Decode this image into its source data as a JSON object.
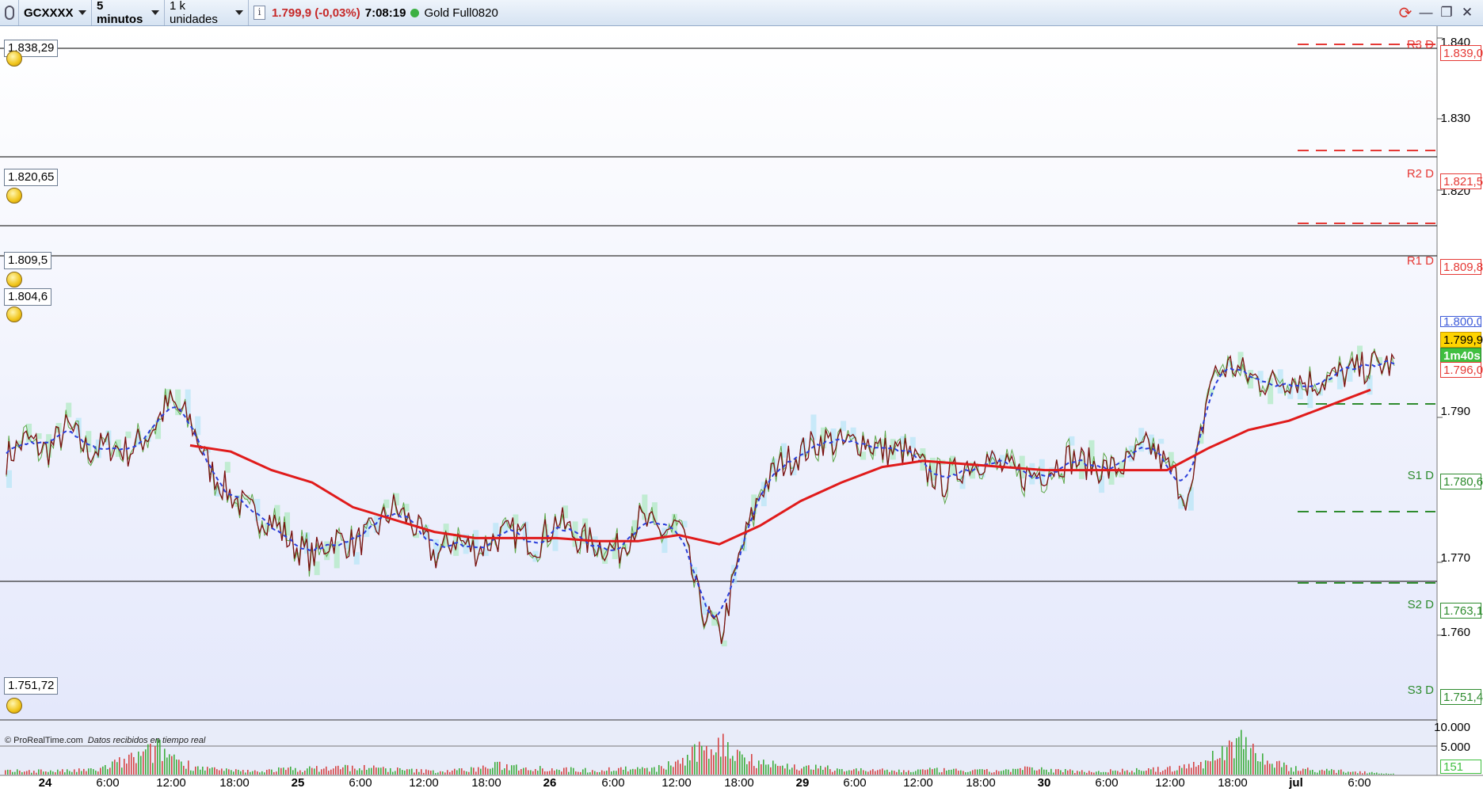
{
  "toolbar": {
    "symbol": "GCXXXX",
    "timeframe": "5 minutos",
    "units": "1 k unidades",
    "info_icon": "info-icon",
    "last_price": "1.799,9 (-0,03%)",
    "time": "7:08:19",
    "instrument": "Gold Full0820",
    "icons": [
      "sync-icon",
      "minimize-icon",
      "restore-icon",
      "close-icon"
    ]
  },
  "alerts": [
    {
      "price": "1.838,29"
    },
    {
      "price": "1.820,65"
    },
    {
      "price": "1.809,5"
    },
    {
      "price": "1.804,6"
    },
    {
      "price": "1.751,72"
    }
  ],
  "pivots": [
    {
      "label": "R3 D",
      "value": "1.839,0",
      "color": "#e53935"
    },
    {
      "label": "R2 D",
      "value": "1.821,5",
      "color": "#e53935"
    },
    {
      "label": "R1 D",
      "value": "1.809,8",
      "color": "#e53935"
    },
    {
      "label": "S1 D",
      "value": "1.780,6",
      "color": "#2e8b2e"
    },
    {
      "label": "S2 D",
      "value": "1.763,1",
      "color": "#2e8b2e"
    },
    {
      "label": "S3 D",
      "value": "1.751,4",
      "color": "#2e8b2e"
    }
  ],
  "y_axis": [
    "1.840",
    "1.830",
    "1.820",
    "1.790",
    "1.770",
    "1.760"
  ],
  "axis_badges": {
    "current_price": "1.799,9",
    "countdown": "1m40s",
    "ma_value": "1.796,0",
    "prev_value": "1.800,0"
  },
  "volume_axis": [
    "10.000",
    "5.000"
  ],
  "volume_current": "151",
  "x_axis": [
    {
      "label": "24",
      "bold": true
    },
    {
      "label": "6:00",
      "bold": false
    },
    {
      "label": "12:00",
      "bold": false
    },
    {
      "label": "18:00",
      "bold": false
    },
    {
      "label": "25",
      "bold": true
    },
    {
      "label": "6:00",
      "bold": false
    },
    {
      "label": "12:00",
      "bold": false
    },
    {
      "label": "18:00",
      "bold": false
    },
    {
      "label": "26",
      "bold": true
    },
    {
      "label": "6:00",
      "bold": false
    },
    {
      "label": "12:00",
      "bold": false
    },
    {
      "label": "18:00",
      "bold": false
    },
    {
      "label": "29",
      "bold": true
    },
    {
      "label": "6:00",
      "bold": false
    },
    {
      "label": "12:00",
      "bold": false
    },
    {
      "label": "18:00",
      "bold": false
    },
    {
      "label": "30",
      "bold": true
    },
    {
      "label": "6:00",
      "bold": false
    },
    {
      "label": "12:00",
      "bold": false
    },
    {
      "label": "18:00",
      "bold": false
    },
    {
      "label": "jul",
      "bold": true
    },
    {
      "label": "6:00",
      "bold": false
    }
  ],
  "credit": {
    "brand": "© ProRealTime.com",
    "note": "Datos recibidos en tiempo real"
  },
  "chart_data": {
    "type": "line",
    "price_path": [
      1785,
      1788,
      1786,
      1790,
      1786,
      1787,
      1786,
      1789,
      1794,
      1791,
      1783,
      1779,
      1776,
      1775,
      1771,
      1769,
      1772,
      1771,
      1773,
      1777,
      1774,
      1769,
      1772,
      1770,
      1772,
      1773,
      1771,
      1775,
      1772,
      1771,
      1770,
      1775,
      1773,
      1774,
      1761,
      1756,
      1770,
      1780,
      1784,
      1786,
      1788,
      1787,
      1788,
      1786,
      1786,
      1783,
      1781,
      1784,
      1785,
      1783,
      1782,
      1783,
      1785,
      1784,
      1783,
      1784,
      1787,
      1783,
      1778,
      1798,
      1800,
      1798,
      1797,
      1798,
      1797,
      1798,
      1799,
      1800,
      1800
    ],
    "ma_path": [
      1787,
      1786,
      1783,
      1781,
      1777,
      1775,
      1773,
      1772,
      1772,
      1772,
      1771.5,
      1771.5,
      1772.5,
      1771,
      1774,
      1778,
      1781,
      1783.5,
      1784.5,
      1784,
      1783.5,
      1783,
      1783,
      1783,
      1783,
      1786.5,
      1789.5,
      1791,
      1793.5,
      1796
    ],
    "volume_profile": [
      900,
      1100,
      1000,
      1400,
      4200,
      7000,
      2500,
      1200,
      900,
      1500,
      1600,
      2000,
      1800,
      1200,
      900,
      1400,
      2500,
      2000,
      1500,
      1200,
      1700,
      1400,
      4000,
      9000,
      5000,
      2500,
      2000,
      1500,
      1200,
      1000,
      1300,
      1100,
      1000,
      1600,
      1200,
      900,
      1100,
      1300,
      1700,
      4000,
      10000,
      3000,
      1500,
      1000,
      800,
      151
    ]
  }
}
